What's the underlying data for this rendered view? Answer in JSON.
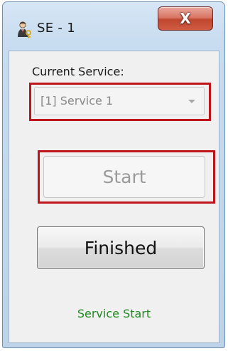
{
  "window": {
    "title": "SE - 1",
    "close_glyph": "X",
    "icon": "user-key-icon"
  },
  "form": {
    "current_service_label": "Current Service:",
    "service_select_value": "[1] Service 1",
    "start_label": "Start",
    "finished_label": "Finished",
    "status_text": "Service Start"
  },
  "colors": {
    "highlight": "#c0141b",
    "status_text": "#1f8a1f",
    "close_button": "#c0472f"
  }
}
